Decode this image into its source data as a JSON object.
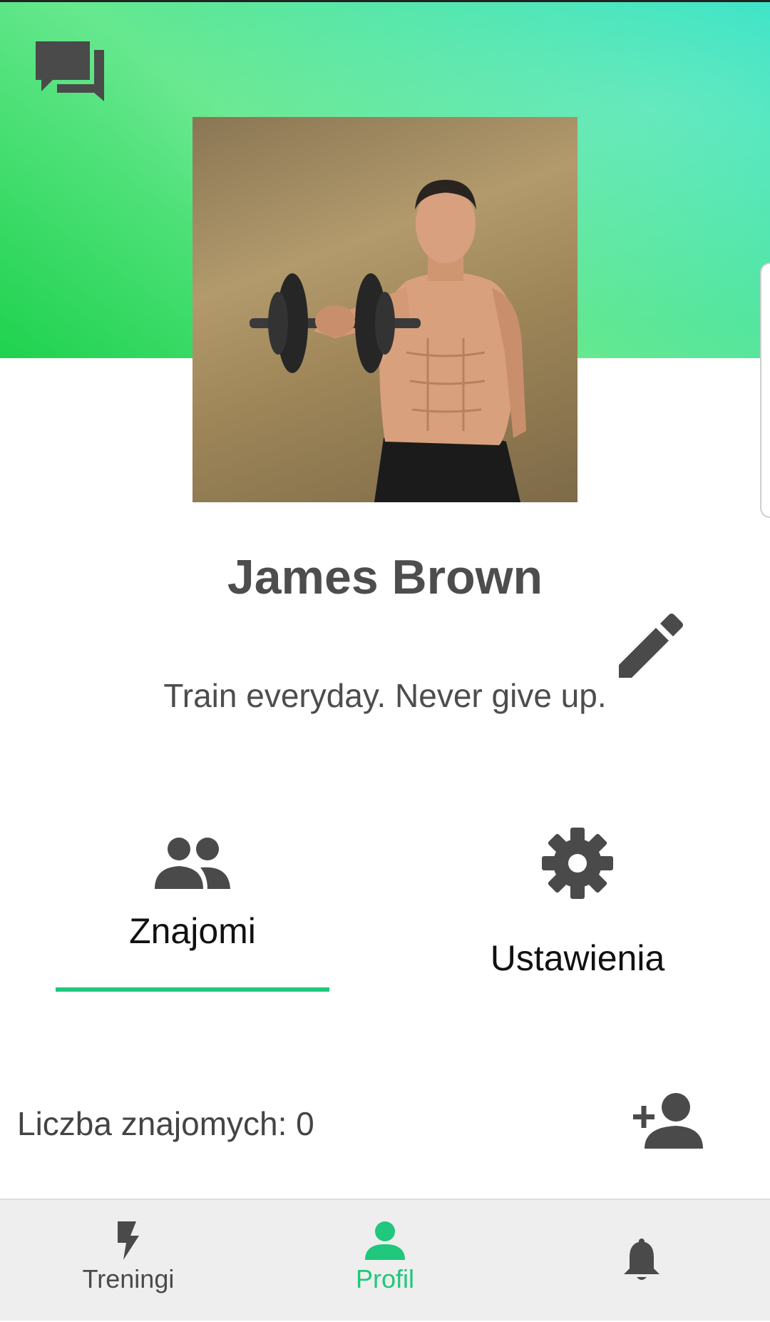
{
  "profile": {
    "name": "James Brown",
    "motto": "Train everyday. Never give up."
  },
  "tabs": [
    {
      "label": "Znajomi",
      "icon": "people-icon",
      "active": true
    },
    {
      "label": "Ustawienia",
      "icon": "gear-icon",
      "active": false
    }
  ],
  "friends": {
    "count_text": "Liczba znajomych: 0"
  },
  "bottom_nav": [
    {
      "label": "Treningi",
      "icon": "lightning-icon",
      "active": false
    },
    {
      "label": "Profil",
      "icon": "person-icon",
      "active": true
    },
    {
      "label": "",
      "icon": "bell-icon",
      "active": false
    }
  ],
  "colors": {
    "accent": "#20c77c",
    "icon_dark": "#4d4d4d",
    "header_gradient": [
      "#1fd24e",
      "#66e88e",
      "#2ee2c4"
    ],
    "nav_background": "#eeeeee"
  }
}
